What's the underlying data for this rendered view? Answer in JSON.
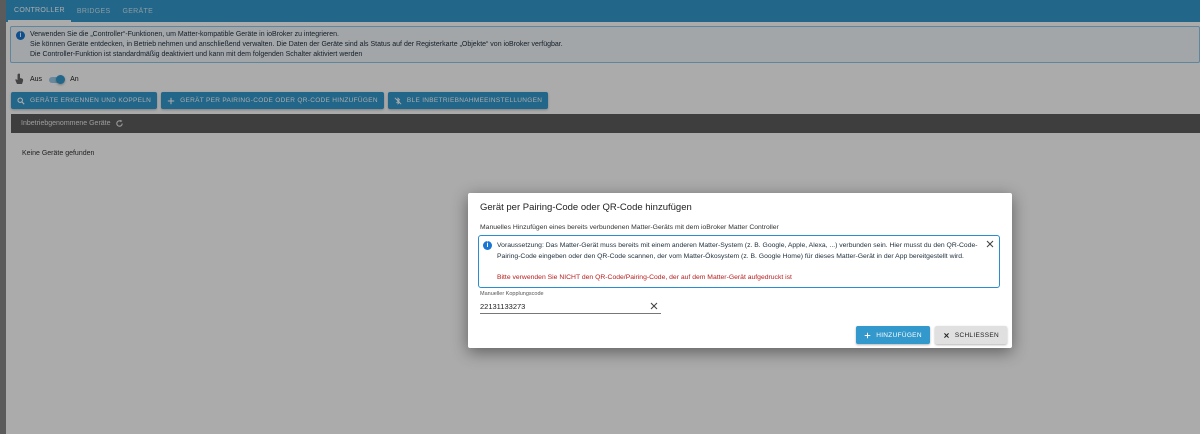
{
  "colors": {
    "primary": "#3399cc",
    "header_bar": "#5d5d5d",
    "warning_text": "#b71c1c",
    "info_blue": "#1976d2"
  },
  "tabs": [
    {
      "label": "CONTROLLER",
      "active": true
    },
    {
      "label": "BRIDGES",
      "active": false
    },
    {
      "label": "GERÄTE",
      "active": false
    }
  ],
  "info": {
    "icon": "info-icon",
    "lines": [
      "Verwenden Sie die „Controller“-Funktionen, um Matter-kompatible Geräte in ioBroker zu integrieren.",
      "Sie können Geräte entdecken, in Betrieb nehmen und anschließend verwalten. Die Daten der Geräte sind als Status auf der Registerkarte „Objekte“ von ioBroker verfügbar.",
      "Die Controller-Funktion ist standardmäßig deaktiviert und kann mit dem folgenden Schalter aktiviert werden"
    ]
  },
  "controller_switch": {
    "icon": "hand-pointer-icon",
    "off_label": "Aus",
    "on_label": "An",
    "checked": true
  },
  "actions": [
    {
      "label": "GERÄTE ERKENNEN UND KOPPELN",
      "icon": "search-icon"
    },
    {
      "label": "GERÄT PER PAIRING-CODE ODER QR-CODE HINZUFÜGEN",
      "icon": "plus-icon"
    },
    {
      "label": "BLE INBETRIEBNAHMEEINSTELLUNGEN",
      "icon": "bluetooth-off-icon"
    }
  ],
  "devices": {
    "header": "Inbetriebgenommene Geräte",
    "refresh_icon": "refresh-icon",
    "empty_text": "Keine Geräte gefunden"
  },
  "dialog": {
    "title": "Gerät per Pairing-Code oder QR-Code hinzufügen",
    "subtitle": "Manuelles Hinzufügen eines bereits verbundenen Matter-Geräts mit dem ioBroker Matter Controller",
    "alert_text": "Voraussetzung: Das Matter-Gerät muss bereits mit einem anderen Matter-System (z. B. Google, Apple, Alexa, ...) verbunden sein. Hier musst du den QR-Code-Pairing-Code eingeben oder den QR-Code scannen, der vom Matter-Ökosystem (z. B. Google Home) für dieses Matter-Gerät in der App bereitgestellt wird.",
    "alert_warning": "Bitte verwenden Sie NICHT den QR-Code/Pairing-Code, der auf dem Matter-Gerät aufgedruckt ist",
    "field_label": "Manueller Kopplungscode",
    "field_value": "22131133273",
    "add_label": "HINZUFÜGEN",
    "close_label": "SCHLIESSEN"
  }
}
